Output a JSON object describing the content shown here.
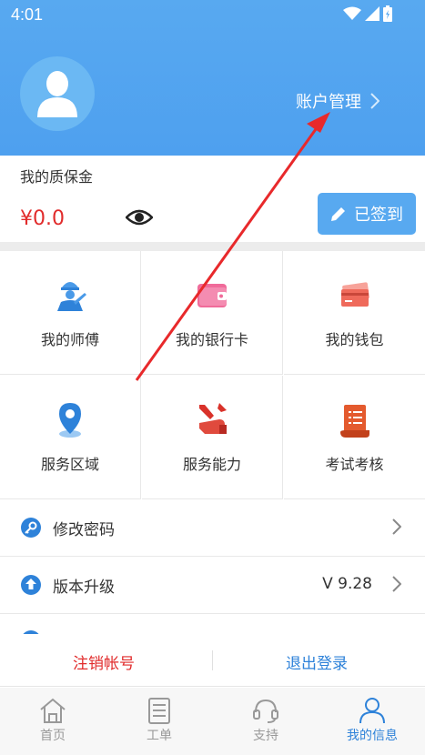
{
  "status": {
    "time": "4:01"
  },
  "header": {
    "account_link": "账户管理"
  },
  "deposit": {
    "label": "我的质保金",
    "amount": "¥0.0",
    "signed_label": "已签到"
  },
  "grid": [
    {
      "label": "我的师傅",
      "icon": "master-icon"
    },
    {
      "label": "我的银行卡",
      "icon": "wallet-card-icon"
    },
    {
      "label": "我的钱包",
      "icon": "cards-icon"
    },
    {
      "label": "服务区域",
      "icon": "location-pin-icon"
    },
    {
      "label": "服务能力",
      "icon": "tools-hand-icon"
    },
    {
      "label": "考试考核",
      "icon": "scroll-icon"
    }
  ],
  "rows": [
    {
      "label": "修改密码",
      "icon": "key-icon",
      "value": ""
    },
    {
      "label": "版本升级",
      "icon": "upgrade-icon",
      "value": "V 9.28"
    }
  ],
  "actions": {
    "cancel": "注销帐号",
    "logout": "退出登录"
  },
  "tabs": [
    {
      "label": "首页",
      "icon": "home-icon"
    },
    {
      "label": "工单",
      "icon": "document-icon"
    },
    {
      "label": "支持",
      "icon": "headset-icon"
    },
    {
      "label": "我的信息",
      "icon": "user-icon"
    }
  ],
  "colors": {
    "header": "#58a9f0",
    "accent": "#2e82d9",
    "price": "#e12b2b",
    "annotation_arrow": "#e8292b"
  }
}
